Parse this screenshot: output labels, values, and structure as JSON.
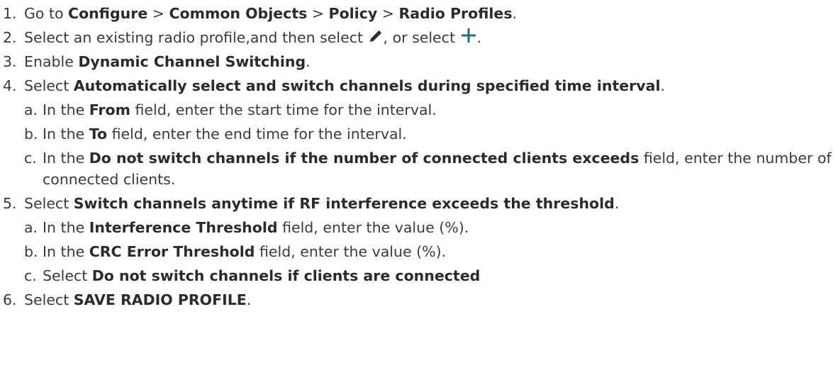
{
  "steps": [
    {
      "num": "1.",
      "parts": {
        "t1": "Go to ",
        "b1": "Configure",
        "t2": " > ",
        "b2": "Common Objects",
        "t3": " > ",
        "b3": "Policy",
        "t4": " > ",
        "b4": "Radio Profiles",
        "t5": "."
      }
    },
    {
      "num": "2.",
      "parts": {
        "t1": "Select an existing radio profile,and then select ",
        "t2": ", or select ",
        "t3": "."
      },
      "icons": {
        "edit": "pencil-icon",
        "add": "plus-icon",
        "add_color": "#1f6f8b"
      }
    },
    {
      "num": "3.",
      "parts": {
        "t1": "Enable ",
        "b1": "Dynamic Channel Switching",
        "t2": "."
      }
    },
    {
      "num": "4.",
      "parts": {
        "t1": "Select ",
        "b1": "Automatically select and switch channels during specified time interval",
        "t2": "."
      },
      "subs": [
        {
          "letter": "a.",
          "t1": "In the ",
          "b1": "From",
          "t2": " field, enter the start time for the interval."
        },
        {
          "letter": "b.",
          "t1": "In the ",
          "b1": "To",
          "t2": " field, enter the end time for the interval."
        },
        {
          "letter": "c.",
          "t1": "In the ",
          "b1": "Do not switch channels if the number of connected clients exceeds",
          "t2": " field, enter the number of connected clients."
        }
      ]
    },
    {
      "num": "5.",
      "parts": {
        "t1": "Select ",
        "b1": "Switch channels anytime if RF interference exceeds the threshold",
        "t2": "."
      },
      "subs": [
        {
          "letter": "a.",
          "t1": "In the ",
          "b1": "Interference Threshold",
          "t2": " field, enter the value (%)."
        },
        {
          "letter": "b.",
          "t1": "In the ",
          "b1": "CRC Error Threshold",
          "t2": " field, enter the value (%)."
        },
        {
          "letter": "c.",
          "t1": "Select ",
          "b1": "Do not switch channels if clients are connected"
        }
      ]
    },
    {
      "num": "6.",
      "parts": {
        "t1": "Select ",
        "b1": "SAVE RADIO PROFILE",
        "t2": "."
      }
    }
  ]
}
